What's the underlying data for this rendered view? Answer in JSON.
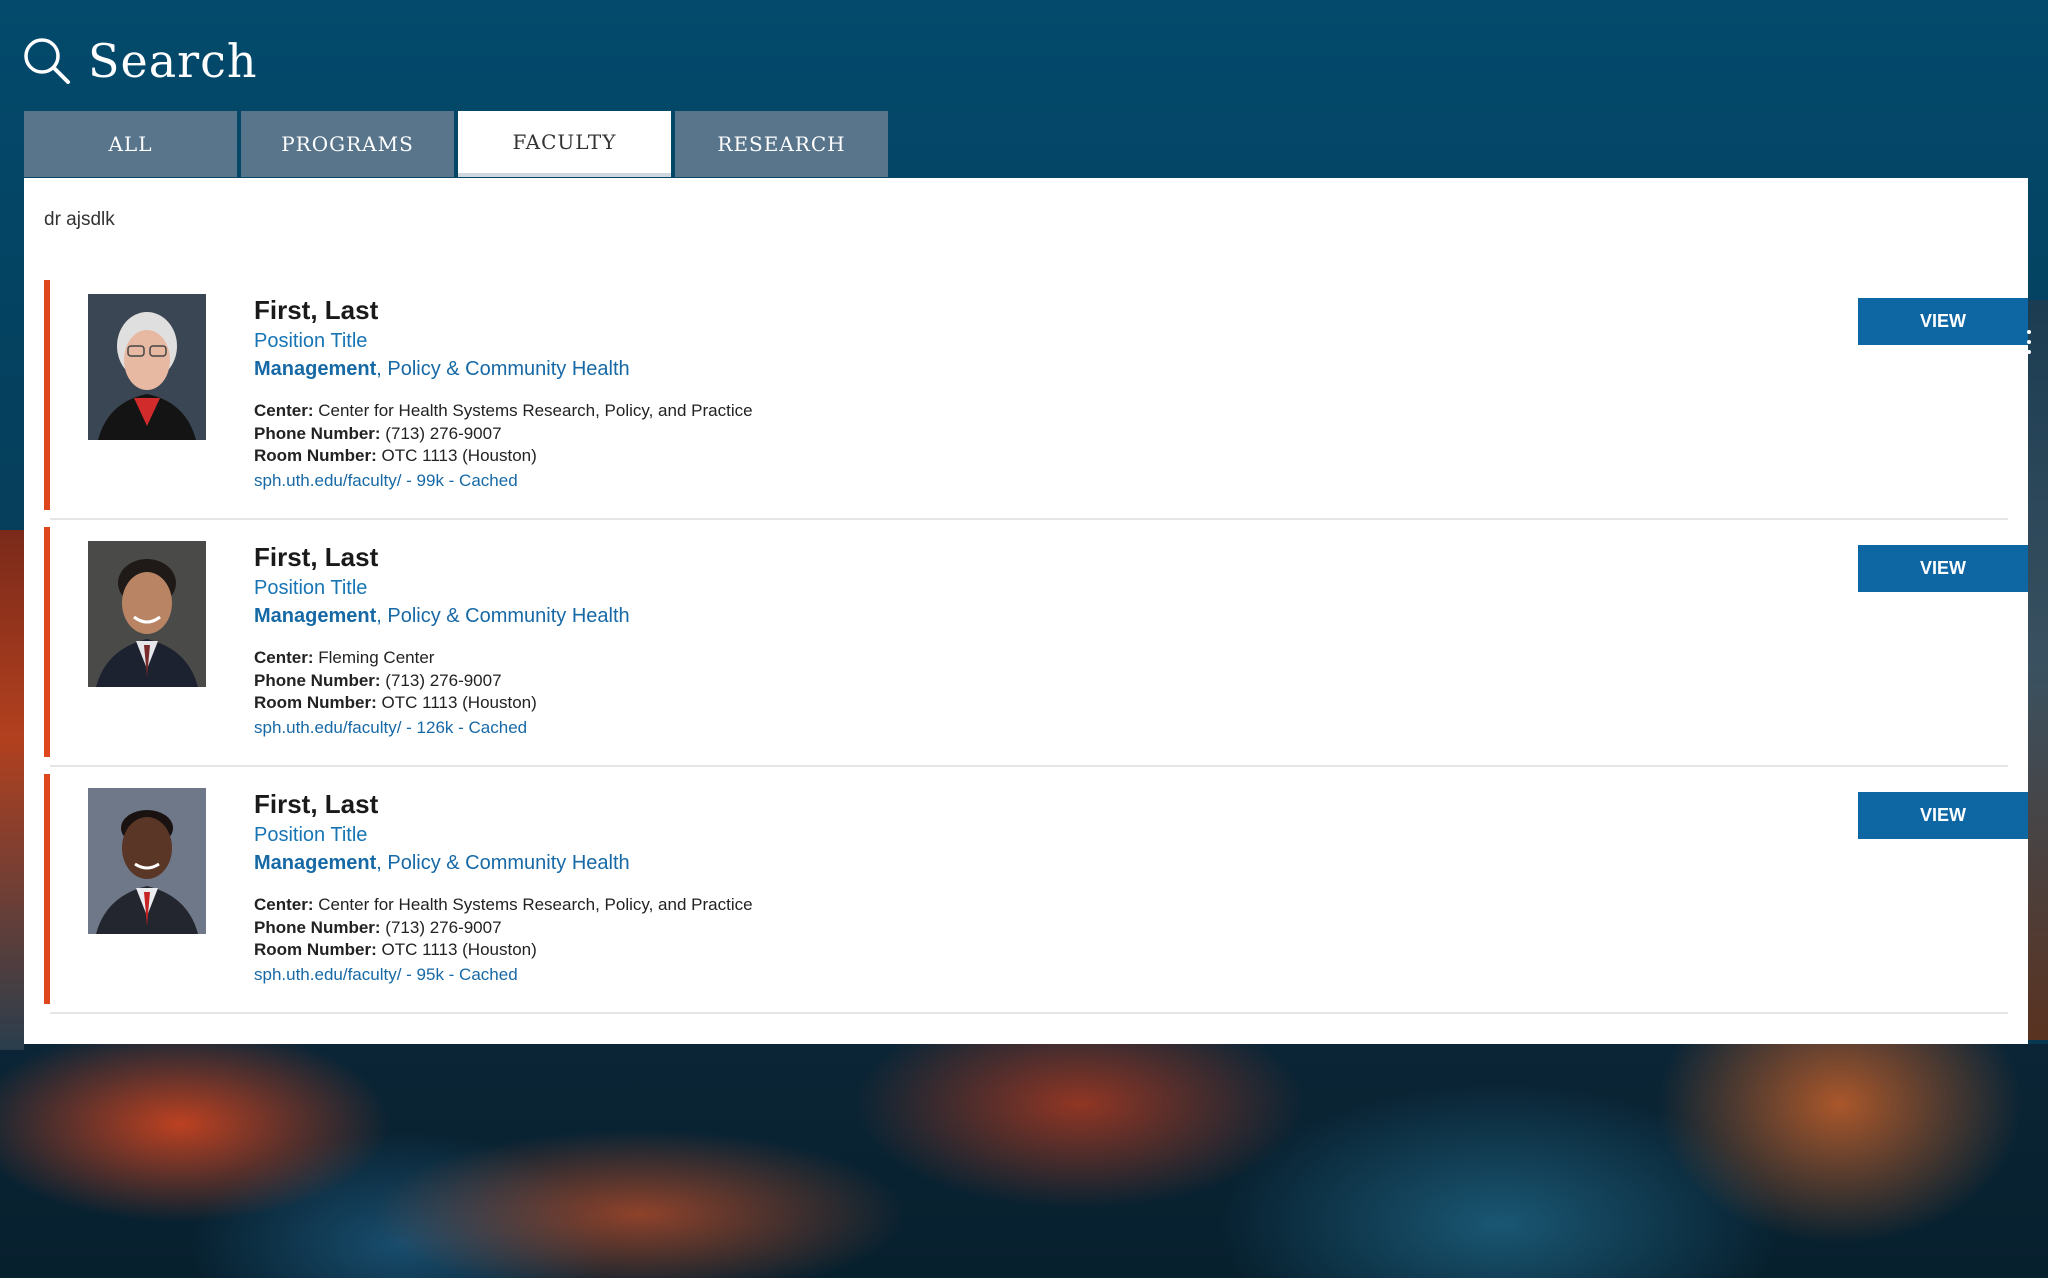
{
  "header": {
    "title": "Search",
    "icon": "search-icon"
  },
  "tabs": [
    {
      "label": "ALL",
      "active": false
    },
    {
      "label": "PROGRAMS",
      "active": false
    },
    {
      "label": "FACULTY",
      "active": true
    },
    {
      "label": "RESEARCH",
      "active": false
    }
  ],
  "search": {
    "value": "dr ajsdlk"
  },
  "results": [
    {
      "name": "First, Last",
      "position": "Position Title",
      "dept_strong": "Management",
      "dept_rest": ", Policy & Community Health",
      "center_label": "Center:",
      "center": "Center for Health Systems Research, Policy, and Practice",
      "phone_label": "Phone Number:",
      "phone": "(713) 276-9007",
      "room_label": "Room Number:",
      "room": "OTC 1113 (Houston)",
      "url": "sph.uth.edu/faculty/ - 99k - Cached",
      "view_label": "VIEW"
    },
    {
      "name": "First, Last",
      "position": "Position Title",
      "dept_strong": "Management",
      "dept_rest": ", Policy & Community Health",
      "center_label": "Center:",
      "center": "Fleming Center",
      "phone_label": "Phone Number:",
      "phone": "(713) 276-9007",
      "room_label": "Room Number:",
      "room": "OTC 1113 (Houston)",
      "url": "sph.uth.edu/faculty/ - 126k - Cached",
      "view_label": "VIEW"
    },
    {
      "name": "First, Last",
      "position": "Position Title",
      "dept_strong": "Management",
      "dept_rest": ", Policy & Community Health",
      "center_label": "Center:",
      "center": "Center for Health Systems Research, Policy, and Practice",
      "phone_label": "Phone Number:",
      "phone": "(713) 276-9007",
      "room_label": "Room Number:",
      "room": "OTC 1113 (Houston)",
      "url": "sph.uth.edu/faculty/ - 95k - Cached",
      "view_label": "VIEW"
    }
  ],
  "colors": {
    "accent_bar": "#e0461e",
    "link_blue": "#1769a6",
    "button_blue": "#0e66a3",
    "tab_inactive": "#58758c",
    "header_bg": "#034a6c"
  }
}
